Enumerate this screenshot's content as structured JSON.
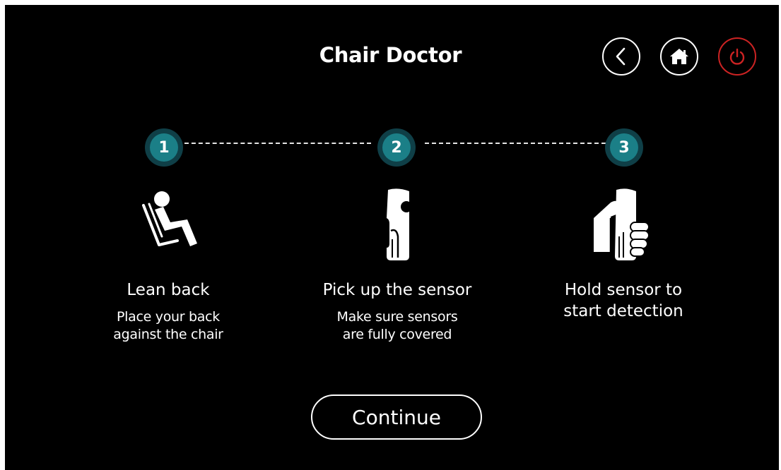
{
  "header": {
    "title": "Chair Doctor",
    "buttons": [
      {
        "name": "back",
        "icon": "chevron-left-icon"
      },
      {
        "name": "home",
        "icon": "home-icon"
      },
      {
        "name": "power",
        "icon": "power-icon",
        "color": "#cc2323"
      }
    ]
  },
  "colors": {
    "background": "#000000",
    "step_badge_outer": "#0f3f47",
    "step_badge_inner": "#1b7f87",
    "power_accent": "#cc2323"
  },
  "steps": [
    {
      "number": "1",
      "icon": "reclining-person-icon",
      "title": "Lean back",
      "description_line1": "Place your back",
      "description_line2": "against the chair"
    },
    {
      "number": "2",
      "icon": "sensor-handle-icon",
      "title": "Pick up the sensor",
      "description_line1": "Make sure sensors",
      "description_line2": "are fully covered"
    },
    {
      "number": "3",
      "icon": "hand-holding-sensor-icon",
      "title_line1": "Hold sensor to",
      "title_line2": "start detection"
    }
  ],
  "continue_label": "Continue"
}
